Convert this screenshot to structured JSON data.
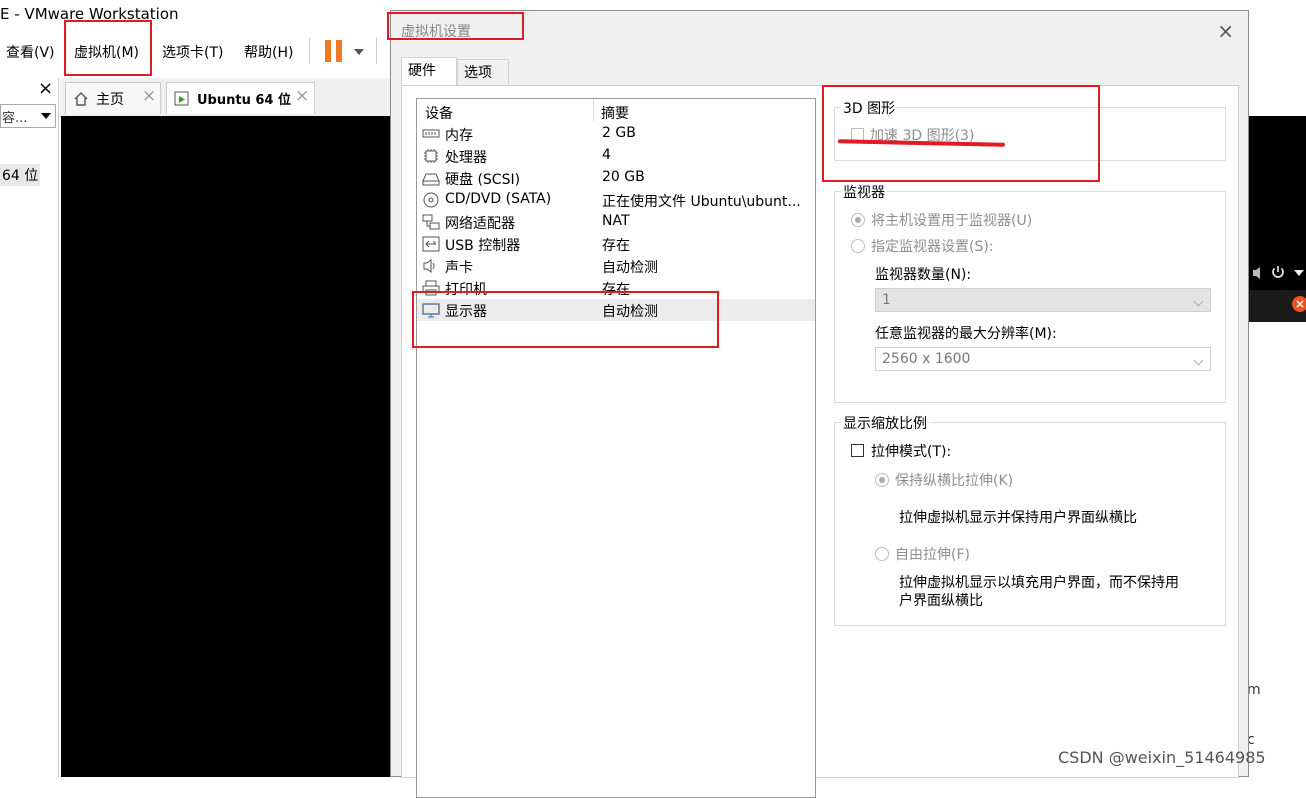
{
  "app": {
    "title": "E - VMware Workstation",
    "menu": [
      "查看(V)",
      "虚拟机(M)",
      "选项卡(T)",
      "帮助(H)"
    ],
    "library_close": "×",
    "library_search": "容...",
    "library_vm": "64 位",
    "tabs": [
      {
        "label": "主页",
        "icon": "home-icon"
      },
      {
        "label": "Ubuntu 64 位",
        "icon": "vm-running-icon"
      }
    ],
    "tab_close": "×",
    "right_fragments": [
      "m",
      "c"
    ]
  },
  "dialog": {
    "title": "虚拟机设置",
    "close": "×",
    "tabs": [
      "硬件",
      "选项"
    ],
    "devices_header": {
      "device": "设备",
      "summary": "摘要"
    },
    "devices": [
      {
        "name": "内存",
        "summary": "2 GB",
        "icon": "memory-icon"
      },
      {
        "name": "处理器",
        "summary": "4",
        "icon": "cpu-icon"
      },
      {
        "name": "硬盘 (SCSI)",
        "summary": "20 GB",
        "icon": "harddisk-icon"
      },
      {
        "name": "CD/DVD (SATA)",
        "summary": "正在使用文件 Ubuntu\\ubunt...",
        "icon": "cd-icon"
      },
      {
        "name": "网络适配器",
        "summary": "NAT",
        "icon": "network-icon"
      },
      {
        "name": "USB 控制器",
        "summary": "存在",
        "icon": "usb-icon"
      },
      {
        "name": "声卡",
        "summary": "自动检测",
        "icon": "speaker-icon"
      },
      {
        "name": "打印机",
        "summary": "存在",
        "icon": "printer-icon"
      },
      {
        "name": "显示器",
        "summary": "自动检测",
        "icon": "monitor-icon"
      }
    ],
    "selected_device": "显示器",
    "graphics3d": {
      "group": "3D 图形",
      "accelerate": "加速 3D 图形(3)",
      "accelerate_checked": false
    },
    "monitor": {
      "group": "监视器",
      "use_host": "将主机设置用于监视器(U)",
      "specify": "指定监视器设置(S):",
      "count_label": "监视器数量(N):",
      "count_value": "1",
      "maxres_label": "任意监视器的最大分辨率(M):",
      "maxres_value": "2560 x 1600"
    },
    "scaling": {
      "group": "显示缩放比例",
      "stretch": "拉伸模式(T):",
      "keep_ratio": "保持纵横比拉伸(K)",
      "keep_ratio_desc": "拉伸虚拟机显示并保持用户界面纵横比",
      "free": "自由拉伸(F)",
      "free_desc_1": "拉伸虚拟机显示以填充用户界面，而不保持用",
      "free_desc_2": "户界面纵横比"
    }
  },
  "watermark": "CSDN @weixin_51464985",
  "colors": {
    "annotation_red": "#e01b24",
    "pause_orange": "#f07a24"
  }
}
